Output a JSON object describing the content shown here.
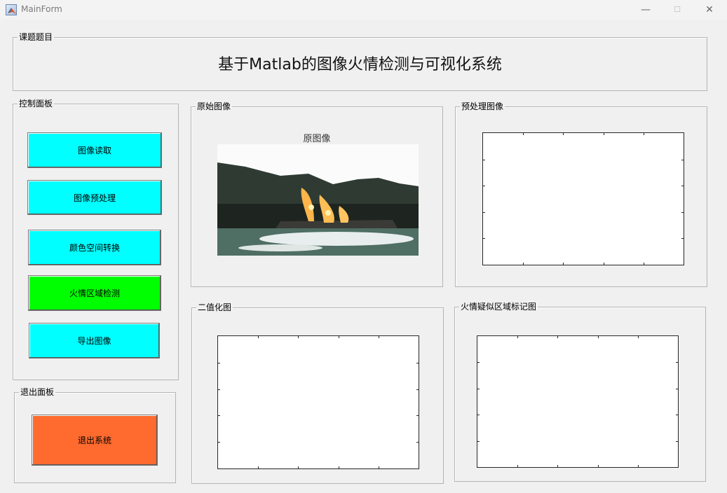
{
  "window": {
    "title": "MainForm",
    "controls": {
      "minimize": "—",
      "maximize": "☐",
      "close": "✕"
    }
  },
  "topic_panel": {
    "label": "课题题目",
    "title": "基于Matlab的图像火情检测与可视化系统"
  },
  "control_panel": {
    "label": "控制面板",
    "buttons": [
      {
        "label": "图像读取",
        "color": "#00ffff"
      },
      {
        "label": "图像预处理",
        "color": "#00ffff"
      },
      {
        "label": "颜色空间转换",
        "color": "#00ffff"
      },
      {
        "label": "火情区域检测",
        "color": "#00ff00"
      },
      {
        "label": "导出图像",
        "color": "#00ffff"
      }
    ]
  },
  "exit_panel": {
    "label": "退出面板",
    "button": {
      "label": "退出系统",
      "color": "#ff6a2e"
    }
  },
  "original_panel": {
    "label": "原始图像",
    "axes_title": "原图像"
  },
  "preprocess_panel": {
    "label": "预处理图像"
  },
  "binary_panel": {
    "label": "二值化图"
  },
  "marked_panel": {
    "label": "火情疑似区域标记图"
  }
}
